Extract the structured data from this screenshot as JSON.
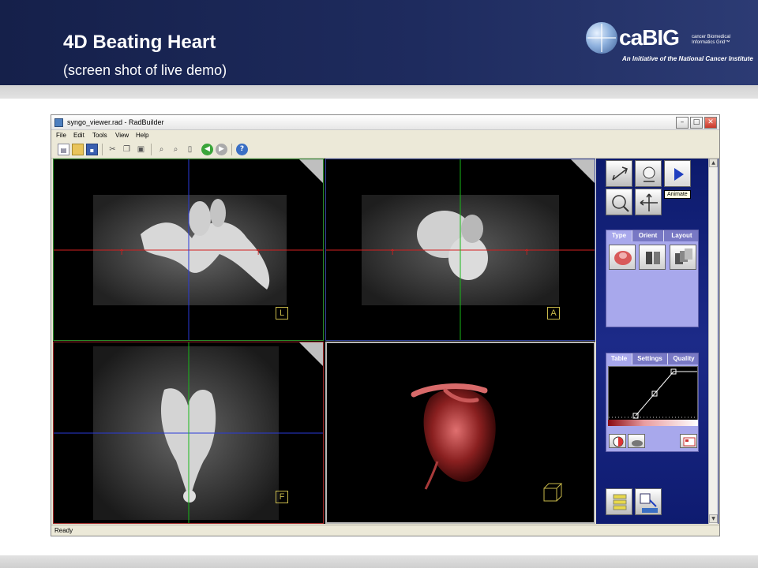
{
  "slide": {
    "title": "4D Beating Heart",
    "subtitle": "(screen shot of live demo)",
    "logo": {
      "name": "caBIG",
      "small_text": "cancer Biomedical Informatics Grid™",
      "tagline": "An Initiative of the National Cancer Institute"
    }
  },
  "window": {
    "title": "syngo_viewer.rad - RadBuilder",
    "controls": {
      "minimize": "–",
      "maximize": "□",
      "close": "✕"
    },
    "menu": [
      "File",
      "Edit",
      "Tools",
      "View",
      "Help"
    ],
    "status": "Ready"
  },
  "viewports": {
    "axial_label": "L",
    "coronal_label": "A",
    "sagittal_label": "F"
  },
  "right_panel": {
    "tooltip": "Animate",
    "type_tabs": [
      "Type",
      "Orient",
      "Layout"
    ],
    "table_tabs": [
      "Table",
      "Settings",
      "Quality"
    ]
  },
  "colors": {
    "banner": "#1e2b5e",
    "panel": "#1c2a88",
    "tab_active": "#a8a8ec",
    "crosshair_red": "#d42020",
    "crosshair_blue": "#2a3ad8",
    "crosshair_green": "#18b818",
    "orientation_label": "#c8b94a"
  },
  "icons": [
    "new-file-icon",
    "open-folder-icon",
    "save-icon",
    "cut-icon",
    "copy-icon",
    "paste-icon",
    "zoom-in-icon",
    "zoom-out-icon",
    "page-icon",
    "back-icon",
    "forward-icon",
    "help-icon"
  ]
}
